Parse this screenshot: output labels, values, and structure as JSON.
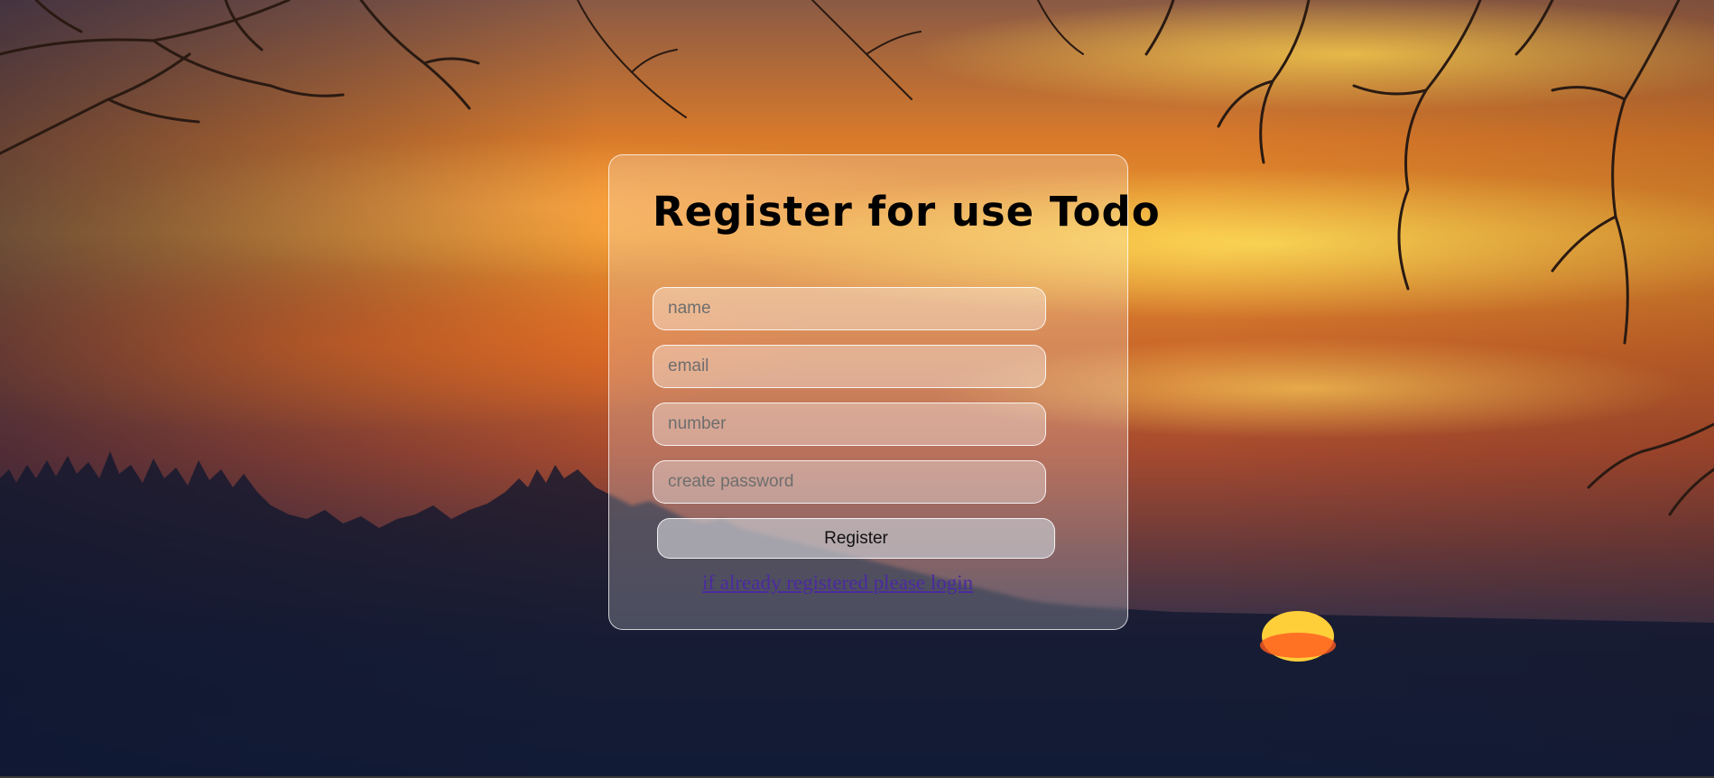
{
  "page": {
    "title": "Register for use Todo"
  },
  "form": {
    "name_placeholder": "name",
    "email_placeholder": "email",
    "number_placeholder": "number",
    "password_placeholder": "create password",
    "register_label": "Register",
    "login_link_text": "if already registered please login"
  },
  "colors": {
    "link": "#4b2aa0",
    "title": "#000000",
    "sun": "#ffcf3a"
  },
  "icons": {
    "background": "sunset-forest-image"
  }
}
